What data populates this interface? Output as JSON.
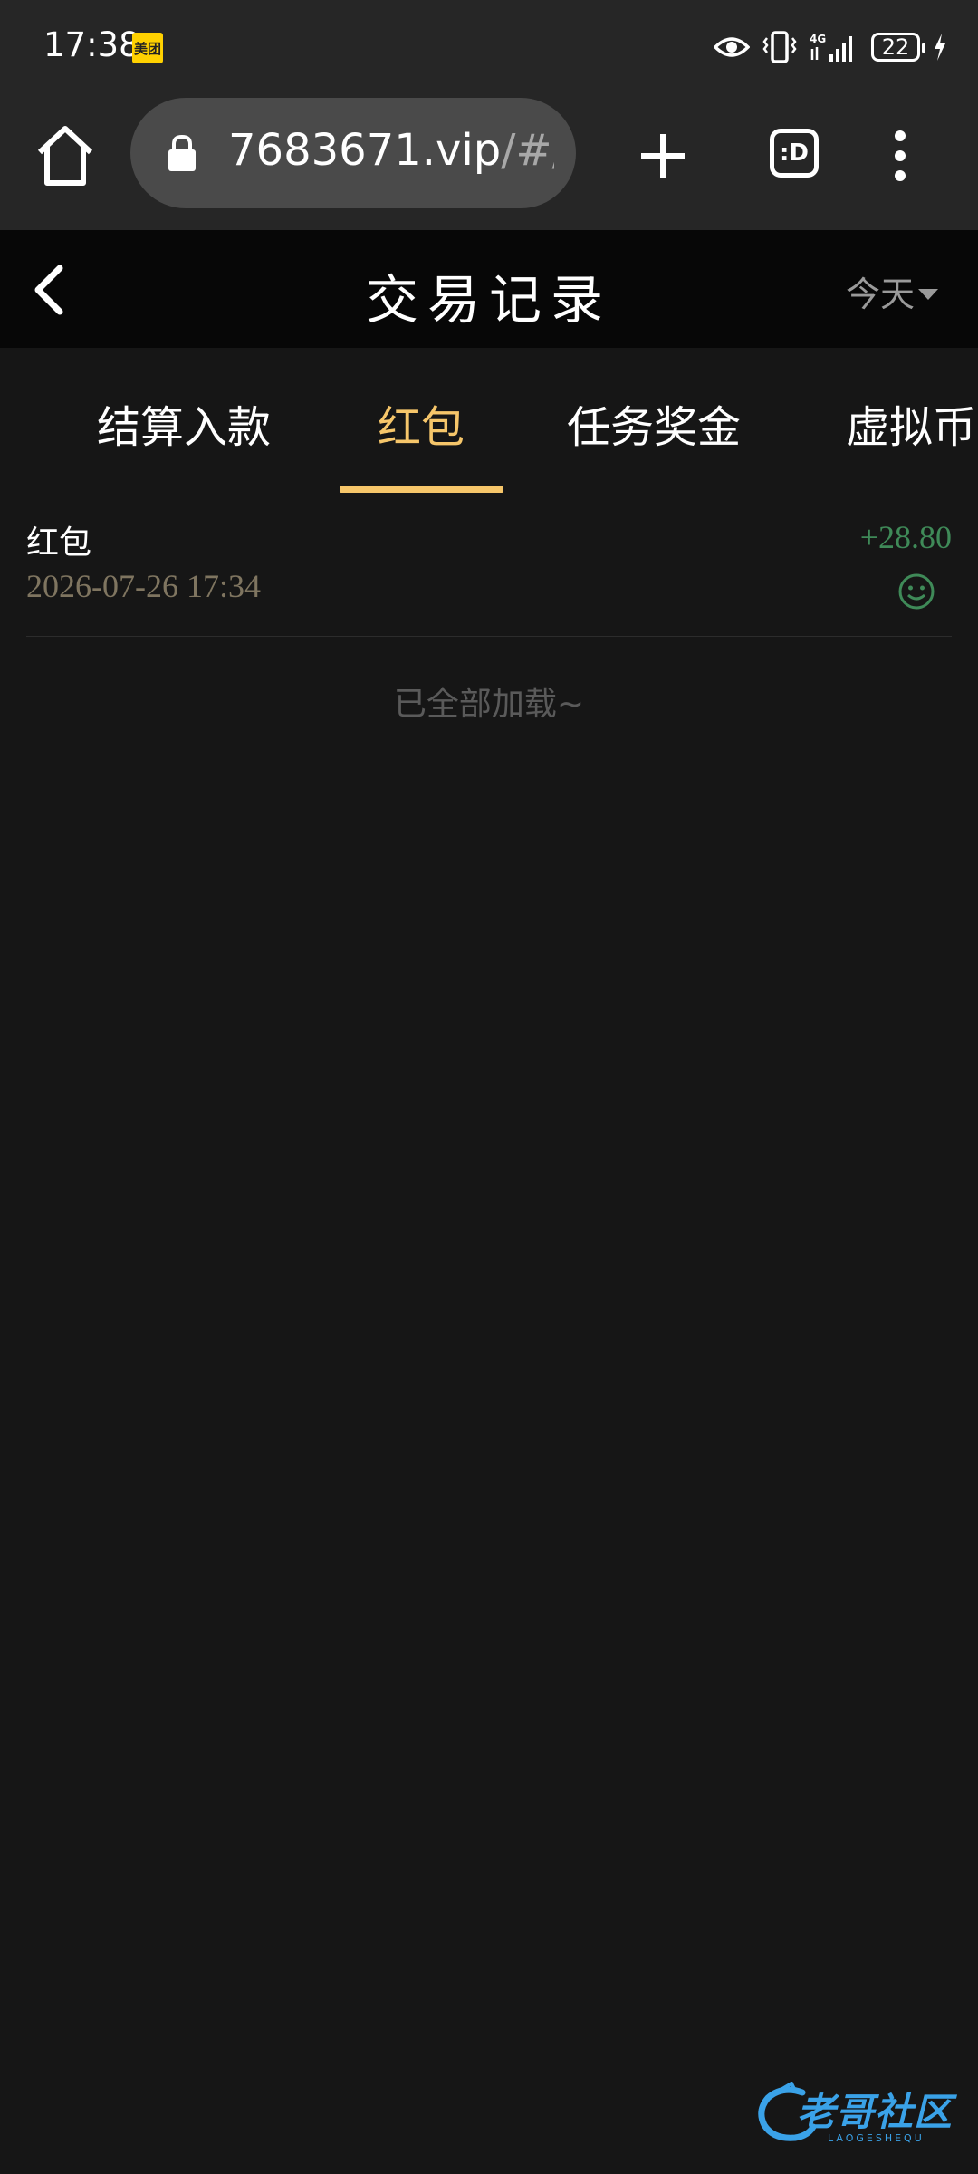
{
  "status_bar": {
    "time": "17:38",
    "app_badge": "美团",
    "network": "4G",
    "battery": "22"
  },
  "browser": {
    "url_main": "7683671.vip",
    "url_rest": "/#/r",
    "tabs_label": ":D"
  },
  "header": {
    "title": "交易记录",
    "date_filter": "今天"
  },
  "tabs": [
    {
      "label": "结算入款",
      "active": false
    },
    {
      "label": "红包",
      "active": true
    },
    {
      "label": "任务奖金",
      "active": false
    },
    {
      "label": "虚拟币",
      "active": false
    }
  ],
  "records": [
    {
      "title": "红包",
      "time": "2026-07-26 17:34",
      "amount": "+28.80"
    }
  ],
  "footer_note": "已全部加载~",
  "watermark": {
    "text": "老哥社区",
    "sub": "LAOGESHEQU"
  },
  "colors": {
    "accent": "#f6c66a",
    "positive": "#3f8a58",
    "background": "#161616",
    "header_bg": "#070707"
  }
}
